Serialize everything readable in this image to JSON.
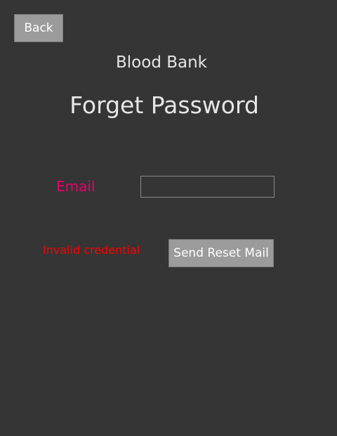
{
  "header": {
    "back_label": "Back",
    "app_title": "Blood Bank",
    "page_title": "Forget Password"
  },
  "form": {
    "email_label": "Email",
    "email_value": "",
    "error_message": "Invalid credential",
    "submit_label": "Send Reset Mail"
  },
  "colors": {
    "background": "#353535",
    "button": "#9b9b9b",
    "label_accent": "#e8006c",
    "error": "#ff0000"
  }
}
